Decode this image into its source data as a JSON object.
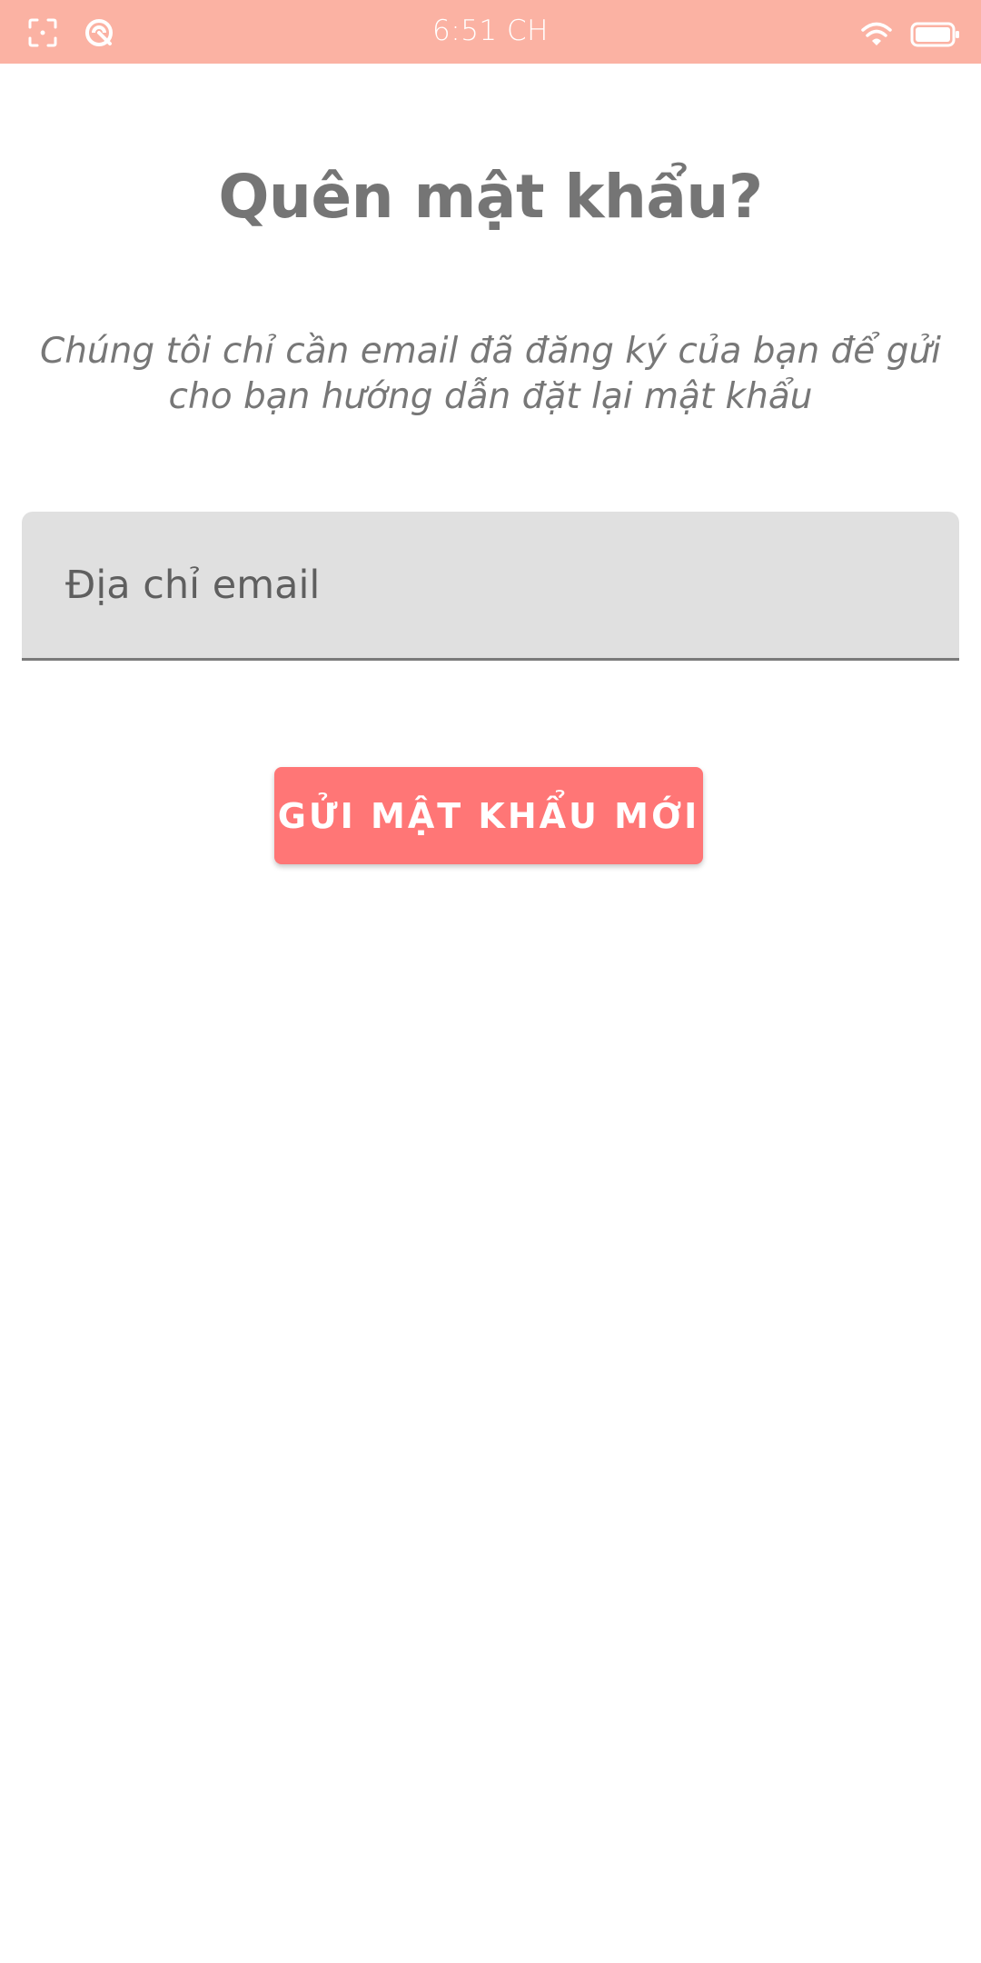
{
  "status_bar": {
    "time": "6:51 CH",
    "background_color": "#fbb2a3",
    "icons_left": [
      "screenshot-icon",
      "data-saver-icon"
    ],
    "icons_right": [
      "wifi-icon",
      "battery-icon"
    ]
  },
  "page": {
    "title": "Quên mật khẩu?",
    "subtitle": "Chúng tôi chỉ cần email đã đăng ký của bạn để gửi cho bạn hướng dẫn đặt lại mật khẩu"
  },
  "form": {
    "email_placeholder": "Địa chỉ email",
    "email_value": "",
    "submit_label": "GỬI MẬT KHẨU MỚI"
  },
  "colors": {
    "title_text": "#757575",
    "button_background": "#ff7676",
    "input_background": "#e0e0e0"
  }
}
